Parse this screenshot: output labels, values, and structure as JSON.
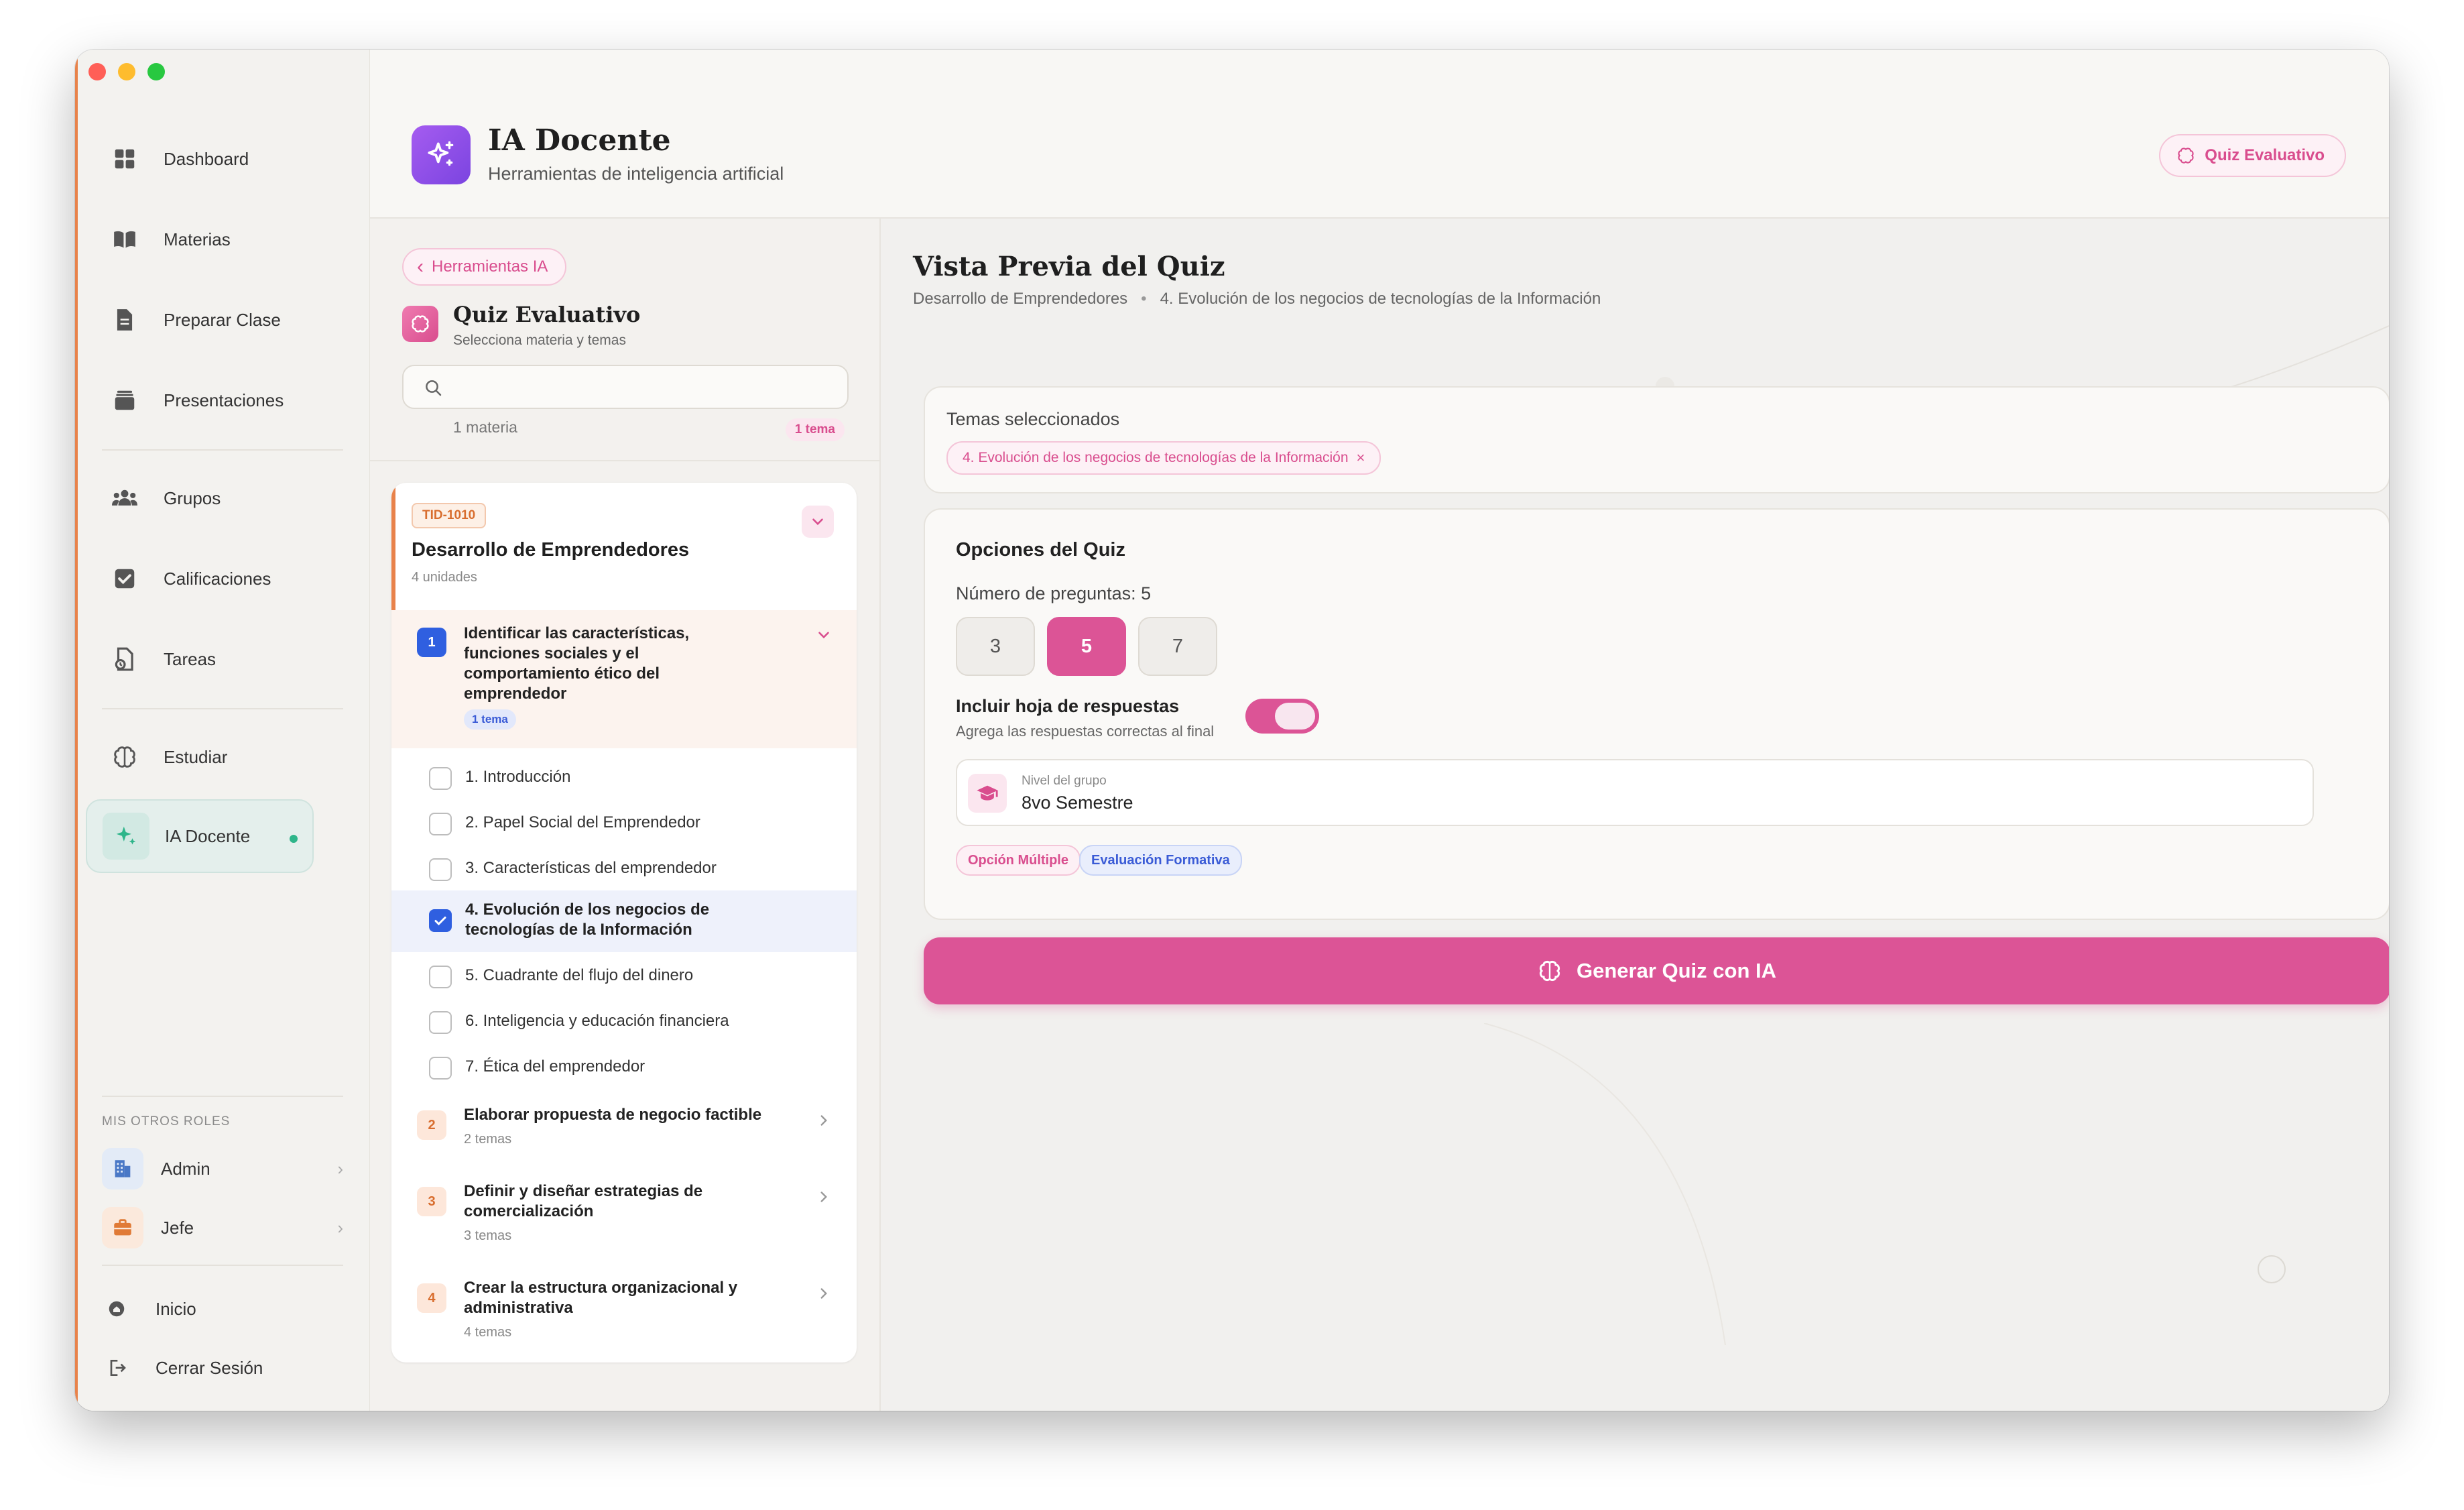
{
  "sidebar": {
    "nav": [
      {
        "label": "Dashboard",
        "icon": "grid-icon"
      },
      {
        "label": "Materias",
        "icon": "book-icon"
      },
      {
        "label": "Preparar Clase",
        "icon": "document-icon"
      },
      {
        "label": "Presentaciones",
        "icon": "archive-icon"
      },
      {
        "label": "Grupos",
        "icon": "users-icon"
      },
      {
        "label": "Calificaciones",
        "icon": "checkbox-icon"
      },
      {
        "label": "Tareas",
        "icon": "task-icon"
      },
      {
        "label": "Estudiar",
        "icon": "brain-icon"
      },
      {
        "label": "IA Docente",
        "icon": "sparkles-icon",
        "active": true
      }
    ],
    "roles_label": "MIS OTROS ROLES",
    "roles": [
      {
        "label": "Admin",
        "icon": "building-icon"
      },
      {
        "label": "Jefe",
        "icon": "briefcase-icon"
      }
    ],
    "bottom": [
      {
        "label": "Inicio",
        "icon": "home-icon"
      },
      {
        "label": "Cerrar Sesión",
        "icon": "logout-icon"
      }
    ]
  },
  "header": {
    "title": "IA Docente",
    "subtitle": "Herramientas de inteligencia artificial",
    "badge": "Quiz Evaluativo"
  },
  "left_panel": {
    "back_label": "Herramientas IA",
    "title": "Quiz Evaluativo",
    "subtitle": "Selecciona materia y temas",
    "search_placeholder": "",
    "count_materias": "1 materia",
    "count_temas": "1 tema",
    "subject": {
      "code": "TID-1010",
      "title": "Desarrollo de Emprendedores",
      "units_text": "4 unidades",
      "units": [
        {
          "num": "1",
          "title_lines": [
            "Identificar las características,",
            "funciones sociales y el",
            "comportamiento ético del",
            "emprendedor"
          ],
          "badge": "1 tema",
          "expanded": true
        },
        {
          "num": "2",
          "title_lines": [
            "Elaborar propuesta de negocio factible"
          ],
          "sub": "2 temas"
        },
        {
          "num": "3",
          "title_lines": [
            "Definir y diseñar estrategias de",
            "comercialización"
          ],
          "sub": "3 temas"
        },
        {
          "num": "4",
          "title_lines": [
            "Crear la estructura organizacional y",
            "administrativa"
          ],
          "sub": "4 temas"
        }
      ],
      "topics": [
        {
          "label": "1. Introducción",
          "checked": false
        },
        {
          "label": "2. Papel Social del Emprendedor",
          "checked": false
        },
        {
          "label": "3. Características del emprendedor",
          "checked": false
        },
        {
          "label_lines": [
            "4. Evolución de los negocios de",
            "tecnologías de la Información"
          ],
          "checked": true
        },
        {
          "label": "5. Cuadrante del flujo del dinero",
          "checked": false
        },
        {
          "label": "6. Inteligencia y educación financiera",
          "checked": false
        },
        {
          "label": "7. Ética del emprendedor",
          "checked": false
        }
      ]
    }
  },
  "preview": {
    "title": "Vista Previa del Quiz",
    "crumb_subject": "Desarrollo de Emprendedores",
    "crumb_topic": "4. Evolución de los negocios de tecnologías de la Información",
    "topics_label": "Temas seleccionados",
    "topic_chip": "4. Evolución de los negocios de tecnologías de la Información",
    "topic_chip_close": "×",
    "options_title": "Opciones del Quiz",
    "questions_label": "Número de preguntas: 5",
    "question_options": [
      "3",
      "5",
      "7"
    ],
    "selected_questions": "5",
    "answers_title": "Incluir hoja de respuestas",
    "answers_sub": "Agrega las respuestas correctas al final",
    "answers_enabled": true,
    "level_label": "Nivel del grupo",
    "level_value": "8vo Semestre",
    "tags": [
      "Opción Múltiple",
      "Evaluación Formativa"
    ],
    "generate_label": "Generar Quiz con IA"
  },
  "colors": {
    "accent_pink": "#dc5496",
    "accent_purple": "#8b4ee8",
    "accent_orange": "#e8824a",
    "accent_blue": "#2f5fe0",
    "active_green": "#2eb58a"
  }
}
